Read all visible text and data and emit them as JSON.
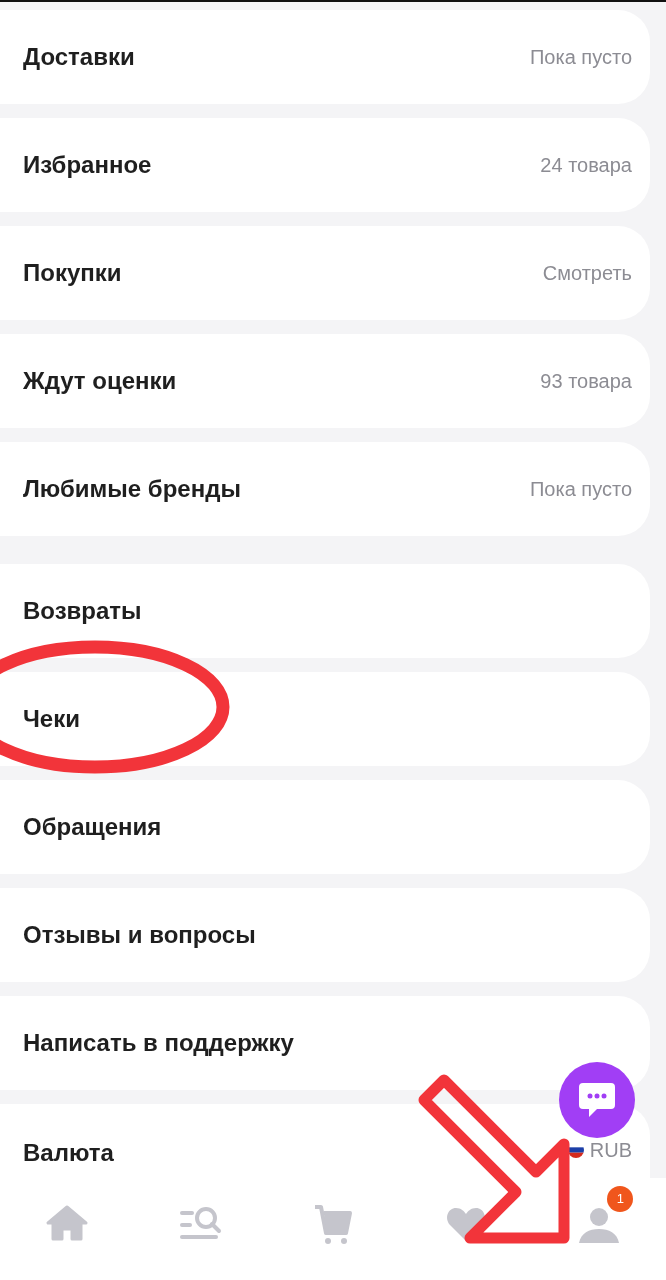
{
  "groups": [
    {
      "items": [
        {
          "kind": "link",
          "label": "Доставки",
          "value": "Пока пусто"
        },
        {
          "kind": "link",
          "label": "Избранное",
          "value": "24 товара"
        },
        {
          "kind": "link",
          "label": "Покупки",
          "value": "Смотреть"
        },
        {
          "kind": "link",
          "label": "Ждут оценки",
          "value": "93 товара"
        },
        {
          "kind": "link",
          "label": "Любимые бренды",
          "value": "Пока пусто"
        }
      ]
    },
    {
      "items": [
        {
          "kind": "link",
          "label": "Возвраты"
        },
        {
          "kind": "link",
          "label": "Чеки"
        },
        {
          "kind": "link",
          "label": "Обращения"
        },
        {
          "kind": "link",
          "label": "Отзывы и вопросы"
        },
        {
          "kind": "link",
          "label": "Написать в поддержку"
        },
        {
          "kind": "currency",
          "label": "Валюта",
          "value": "RUB"
        }
      ]
    }
  ],
  "nav": [
    {
      "kind": "home"
    },
    {
      "kind": "catalog"
    },
    {
      "kind": "cart"
    },
    {
      "kind": "favorites"
    },
    {
      "kind": "profile",
      "badge": "1"
    }
  ],
  "annotations": {
    "ellipse": true,
    "arrow": true
  }
}
